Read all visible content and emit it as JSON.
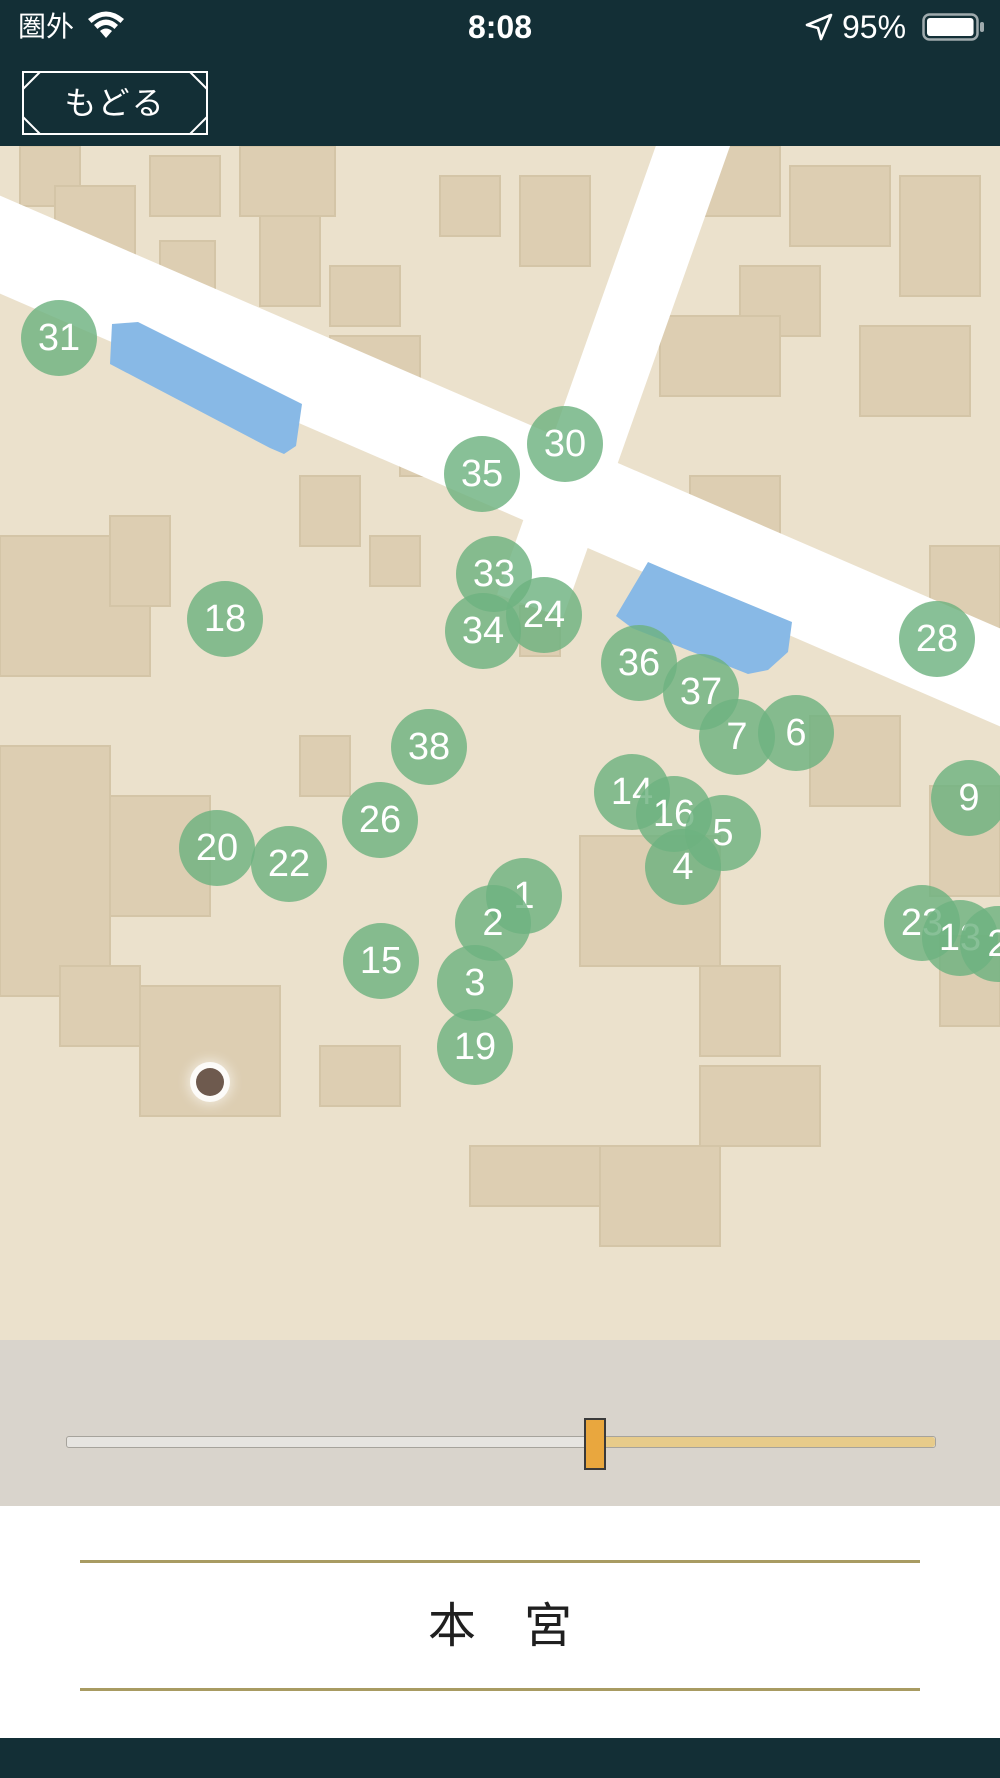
{
  "status_bar": {
    "carrier": "圏外",
    "time": "8:08",
    "battery": "95%",
    "battery_level": 0.95,
    "icons": [
      "wifi-icon",
      "location-arrow-icon",
      "battery-icon"
    ]
  },
  "nav": {
    "back_label": "もどる"
  },
  "map": {
    "markers": [
      {
        "label": "31"
      },
      {
        "label": "30"
      },
      {
        "label": "35"
      },
      {
        "label": "33"
      },
      {
        "label": "18"
      },
      {
        "label": "34"
      },
      {
        "label": "24"
      },
      {
        "label": "28"
      },
      {
        "label": "36"
      },
      {
        "label": "37"
      },
      {
        "label": "7"
      },
      {
        "label": "6"
      },
      {
        "label": "38"
      },
      {
        "label": "14"
      },
      {
        "label": "16"
      },
      {
        "label": "5"
      },
      {
        "label": "9"
      },
      {
        "label": "26"
      },
      {
        "label": "20"
      },
      {
        "label": "22"
      },
      {
        "label": "4"
      },
      {
        "label": "1"
      },
      {
        "label": "2"
      },
      {
        "label": "23"
      },
      {
        "label": "13"
      },
      {
        "label": "2"
      },
      {
        "label": "15"
      },
      {
        "label": "3"
      },
      {
        "label": "19"
      }
    ]
  },
  "slider": {
    "value": 0.609
  },
  "title": {
    "text": "本　宮"
  },
  "colors": {
    "header": "#132f36",
    "marker": "#6eb280",
    "slider_thumb": "#e9a73e",
    "slider_fill": "#e7cb8a",
    "rule": "#a89b62"
  }
}
